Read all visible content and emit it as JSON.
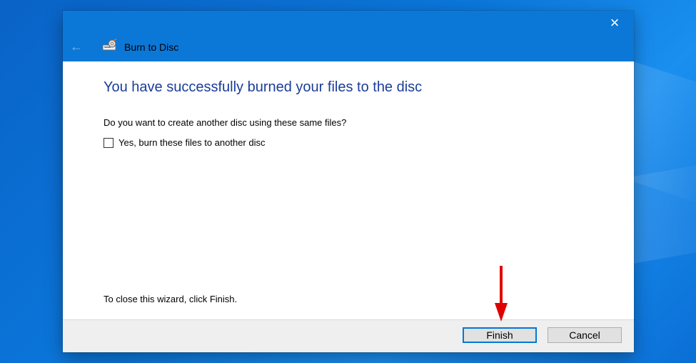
{
  "window": {
    "title": "Burn to Disc",
    "close_label": "×",
    "back_label": "←"
  },
  "content": {
    "heading": "You have successfully burned your files to the disc",
    "question": "Do you want to create another disc using these same files?",
    "checkbox_label": "Yes, burn these files to another disc",
    "checkbox_checked": false,
    "finish_note": "To close this wizard, click Finish."
  },
  "buttons": {
    "finish": "Finish",
    "cancel": "Cancel"
  },
  "colors": {
    "desktop_blue": "#0b78dc",
    "titlebar_blue": "#0b78d7",
    "heading_blue": "#1a3d9a",
    "annotation_red": "#e00000"
  },
  "icons": {
    "disc": "burn-disc-icon",
    "back": "back-arrow-icon",
    "close": "close-icon",
    "annotation": "red-arrow-icon"
  }
}
